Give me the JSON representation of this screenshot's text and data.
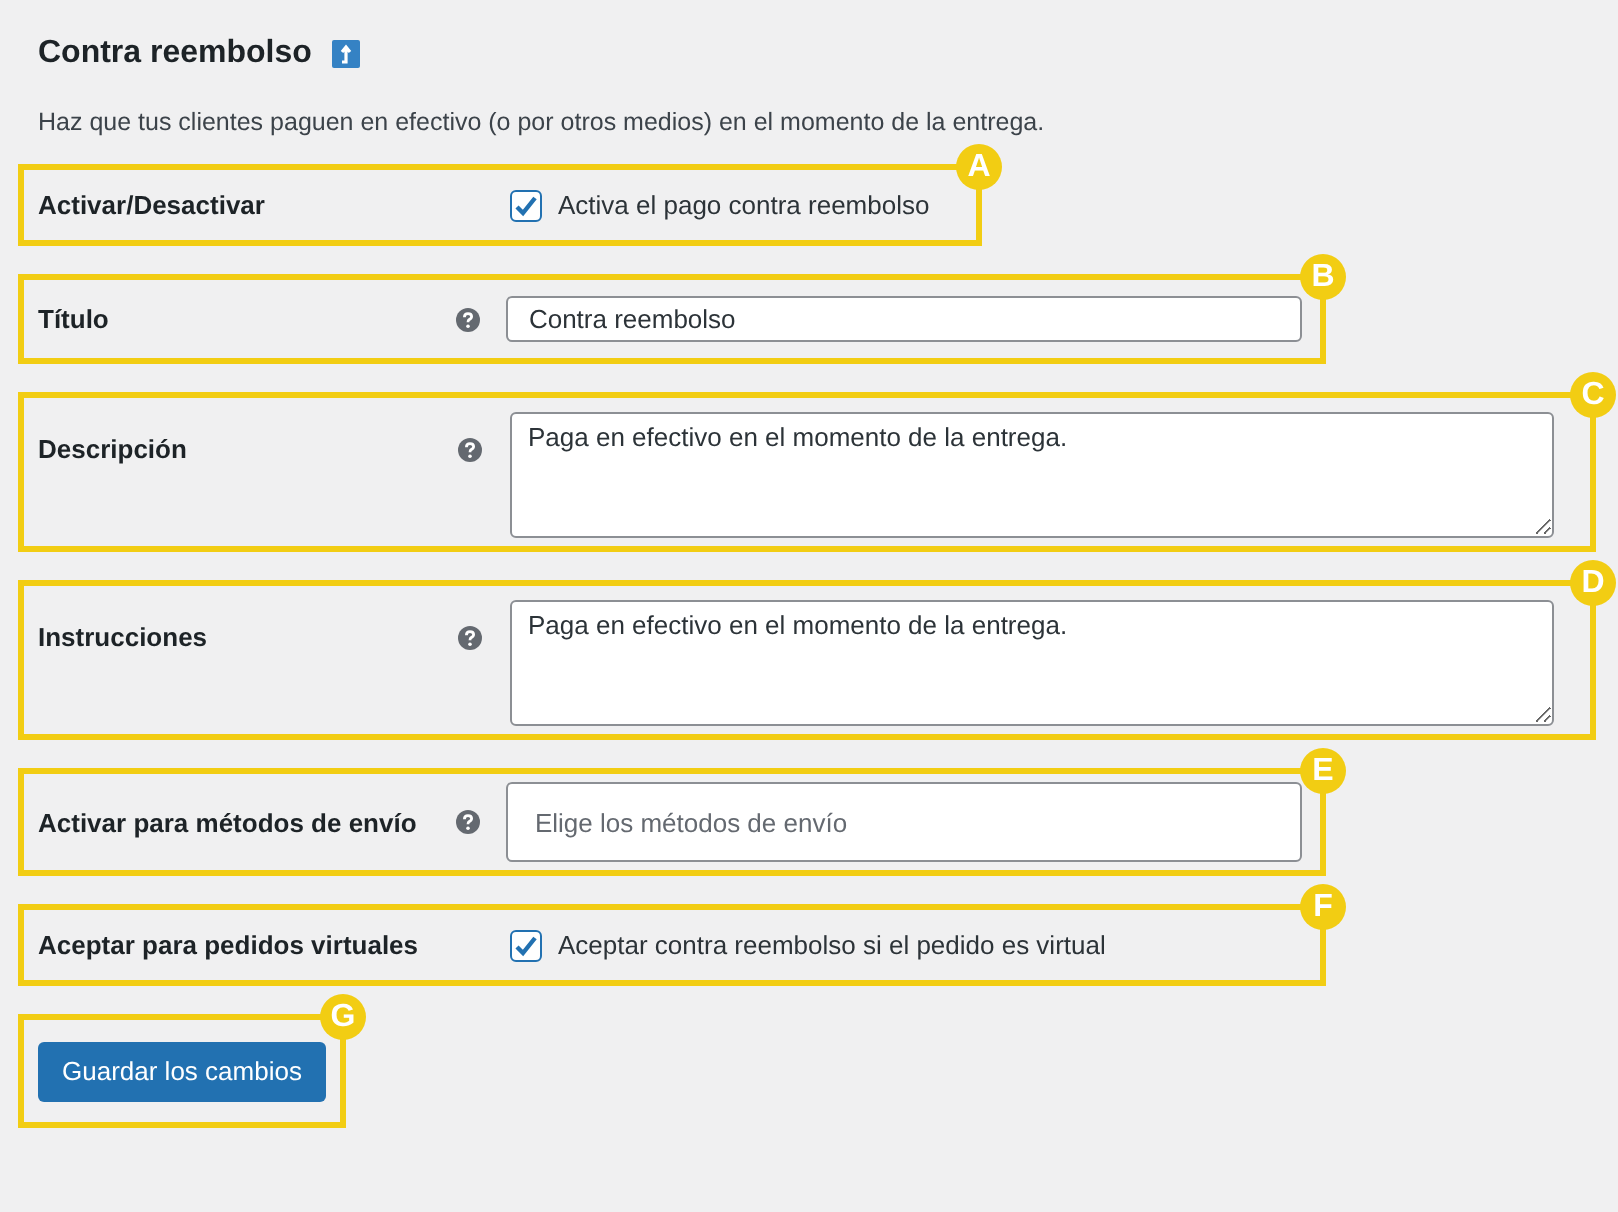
{
  "heading": {
    "title": "Contra reembolso"
  },
  "description": "Haz que tus clientes paguen en efectivo (o por otros medios) en el momento de la entrega.",
  "rows": [
    {
      "kind": "checkbox",
      "badge": "A",
      "label": "Activar/Desactivar",
      "help": false,
      "checked": true,
      "text": "Activa el pago contra reembolso"
    },
    {
      "kind": "text",
      "badge": "B",
      "label": "Título",
      "help": true,
      "value": "Contra reembolso"
    },
    {
      "kind": "textarea",
      "badge": "C",
      "label": "Descripción",
      "help": true,
      "value": "Paga en efectivo en el momento de la entrega."
    },
    {
      "kind": "textarea",
      "badge": "D",
      "label": "Instrucciones",
      "help": true,
      "value": "Paga en efectivo en el momento de la entrega."
    },
    {
      "kind": "select",
      "badge": "E",
      "label": "Activar para métodos de envío",
      "help": true,
      "placeholder": "Elige los métodos de envío"
    },
    {
      "kind": "checkbox",
      "badge": "F",
      "label": "Aceptar para pedidos virtuales",
      "help": false,
      "checked": true,
      "text": "Aceptar contra reembolso si el pedido es virtual"
    }
  ],
  "save_button": {
    "badge": "G",
    "label": "Guardar los cambios"
  }
}
